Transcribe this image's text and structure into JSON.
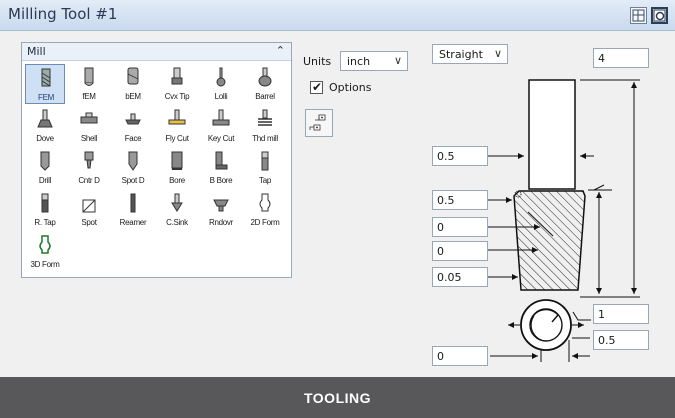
{
  "window": {
    "title": "Milling Tool #1"
  },
  "title_buttons": [
    {
      "icon": "window-layout-icon"
    },
    {
      "icon": "preview-icon"
    }
  ],
  "palette": {
    "title": "Mill",
    "collapse_glyph": "⌃",
    "tools": [
      {
        "label": "FEM",
        "icon": "flat-end-mill-icon",
        "selected": true
      },
      {
        "label": "fEM",
        "icon": "ball-end-mill-icon"
      },
      {
        "label": "bEM",
        "icon": "bull-end-mill-icon"
      },
      {
        "label": "Cvx Tip",
        "icon": "convex-tip-icon"
      },
      {
        "label": "Lolli",
        "icon": "lollipop-icon"
      },
      {
        "label": "Barrel",
        "icon": "barrel-icon"
      },
      {
        "label": "Dove",
        "icon": "dovetail-icon"
      },
      {
        "label": "Shell",
        "icon": "shell-mill-icon"
      },
      {
        "label": "Face",
        "icon": "face-mill-icon"
      },
      {
        "label": "Fly Cut",
        "icon": "fly-cutter-icon"
      },
      {
        "label": "Key Cut",
        "icon": "key-cutter-icon"
      },
      {
        "label": "Thd mill",
        "icon": "thread-mill-icon"
      },
      {
        "label": "Drill",
        "icon": "drill-icon"
      },
      {
        "label": "Cntr D",
        "icon": "center-drill-icon"
      },
      {
        "label": "Spot D",
        "icon": "spot-drill-icon"
      },
      {
        "label": "Bore",
        "icon": "bore-icon"
      },
      {
        "label": "B Bore",
        "icon": "back-bore-icon"
      },
      {
        "label": "Tap",
        "icon": "tap-icon"
      },
      {
        "label": "R. Tap",
        "icon": "rigid-tap-icon"
      },
      {
        "label": "Spot",
        "icon": "spot-face-icon"
      },
      {
        "label": "Reamer",
        "icon": "reamer-icon"
      },
      {
        "label": "C.Sink",
        "icon": "countersink-icon"
      },
      {
        "label": "Rndovr",
        "icon": "round-over-icon"
      },
      {
        "label": "2D Form",
        "icon": "2d-form-icon"
      },
      {
        "label": "3D Form",
        "icon": "3d-form-icon"
      }
    ]
  },
  "units": {
    "label": "Units",
    "value": "inch",
    "caret": "∨"
  },
  "options": {
    "label": "Options",
    "checked": true,
    "check_glyph": "✔"
  },
  "shank": {
    "value": "Straight",
    "caret": "∨"
  },
  "fields": {
    "overall_length": "4",
    "shank_diameter": "0.5",
    "flute_diameter": "0.5",
    "taper_angle": "0",
    "back_angle": "0",
    "corner_radius": "0.05",
    "flute_length": "1",
    "number_of_flutes": "0.5",
    "tip_offset": "0"
  },
  "banner": {
    "text": "TOOLING"
  },
  "colors": {
    "titlebar": "#c9d9ee",
    "banner": "#58585a",
    "selected": "#cfe0f5"
  }
}
